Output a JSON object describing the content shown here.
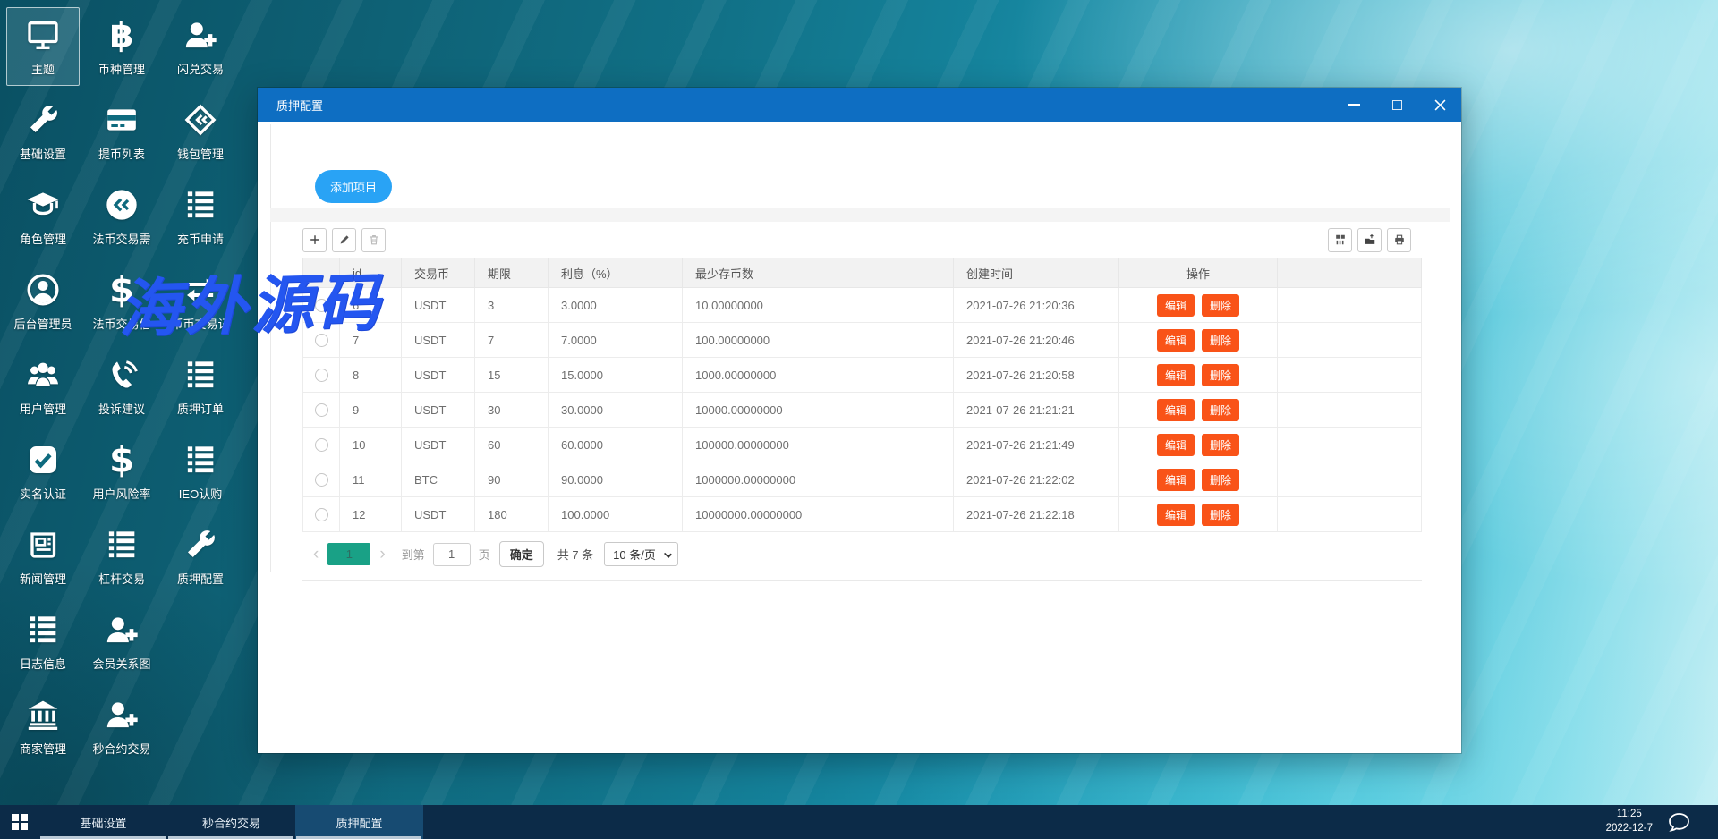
{
  "desktop": {
    "watermark": "海外源码",
    "icons": [
      {
        "label": "主题",
        "icon": "monitor",
        "selected": true
      },
      {
        "label": "币种管理",
        "icon": "bitcoin"
      },
      {
        "label": "闪兑交易",
        "icon": "user-plus"
      },
      {
        "label": "基础设置",
        "icon": "wrench"
      },
      {
        "label": "提币列表",
        "icon": "card"
      },
      {
        "label": "钱包管理",
        "icon": "wallet-chevrons"
      },
      {
        "label": "角色管理",
        "icon": "grad-cap"
      },
      {
        "label": "法币交易需",
        "icon": "circle-chevrons"
      },
      {
        "label": "充币申请",
        "icon": "list"
      },
      {
        "label": "后台管理员",
        "icon": "user-circle"
      },
      {
        "label": "法币交易信",
        "icon": "dollar"
      },
      {
        "label": "币币交易记",
        "icon": "exchange"
      },
      {
        "label": "用户管理",
        "icon": "users"
      },
      {
        "label": "投诉建议",
        "icon": "phone"
      },
      {
        "label": "质押订单",
        "icon": "list"
      },
      {
        "label": "实名认证",
        "icon": "check-square"
      },
      {
        "label": "用户风险率",
        "icon": "dollar"
      },
      {
        "label": "IEO认购",
        "icon": "list"
      },
      {
        "label": "新闻管理",
        "icon": "news"
      },
      {
        "label": "杠杆交易",
        "icon": "list"
      },
      {
        "label": "质押配置",
        "icon": "wrench"
      },
      {
        "label": "日志信息",
        "icon": "list"
      },
      {
        "label": "会员关系图",
        "icon": "user-plus"
      },
      {
        "spacer": true
      },
      {
        "label": "商家管理",
        "icon": "bank"
      },
      {
        "label": "秒合约交易",
        "icon": "user-plus"
      }
    ]
  },
  "window": {
    "title": "质押配置",
    "add_button": "添加项目",
    "table": {
      "headers": [
        "",
        "id",
        "交易币",
        "期限",
        "利息（%）",
        "最少存币数",
        "创建时间",
        "操作",
        ""
      ],
      "edit_label": "编辑",
      "delete_label": "删除",
      "rows": [
        {
          "id": "6",
          "coin": "USDT",
          "period": "3",
          "interest": "3.0000",
          "min_deposit": "10.00000000",
          "created": "2021-07-26 21:20:36"
        },
        {
          "id": "7",
          "coin": "USDT",
          "period": "7",
          "interest": "7.0000",
          "min_deposit": "100.00000000",
          "created": "2021-07-26 21:20:46"
        },
        {
          "id": "8",
          "coin": "USDT",
          "period": "15",
          "interest": "15.0000",
          "min_deposit": "1000.00000000",
          "created": "2021-07-26 21:20:58"
        },
        {
          "id": "9",
          "coin": "USDT",
          "period": "30",
          "interest": "30.0000",
          "min_deposit": "10000.00000000",
          "created": "2021-07-26 21:21:21"
        },
        {
          "id": "10",
          "coin": "USDT",
          "period": "60",
          "interest": "60.0000",
          "min_deposit": "100000.00000000",
          "created": "2021-07-26 21:21:49"
        },
        {
          "id": "11",
          "coin": "BTC",
          "period": "90",
          "interest": "90.0000",
          "min_deposit": "1000000.00000000",
          "created": "2021-07-26 21:22:02"
        },
        {
          "id": "12",
          "coin": "USDT",
          "period": "180",
          "interest": "100.0000",
          "min_deposit": "10000000.00000000",
          "created": "2021-07-26 21:22:18"
        }
      ]
    },
    "pagination": {
      "current_page": "1",
      "goto_prefix": "到第",
      "goto_value": "1",
      "goto_suffix": "页",
      "confirm_label": "确定",
      "total_label": "共 7 条",
      "page_size": "10 条/页"
    }
  },
  "taskbar": {
    "items": [
      {
        "label": "基础设置",
        "active": false
      },
      {
        "label": "秒合约交易",
        "active": false
      },
      {
        "label": "质押配置",
        "active": true
      }
    ],
    "clock_time": "11:25",
    "clock_date": "2022-12-7"
  },
  "colors": {
    "titlebar_blue": "#0e6ec2",
    "accent_blue": "#29a3f5",
    "action_orange": "#f95318",
    "pagination_teal": "#19a186",
    "taskbar_navy": "#0c2b48",
    "watermark_blue": "#2456f0"
  }
}
